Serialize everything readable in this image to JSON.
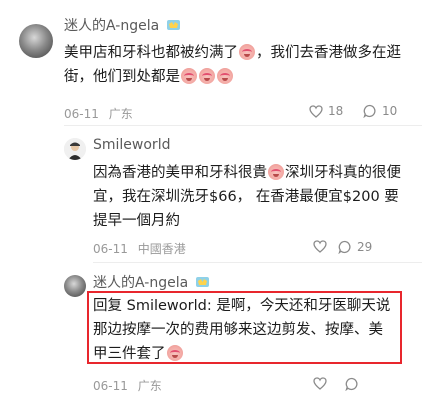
{
  "comments": [
    {
      "author": "迷人的A-ngela",
      "text_parts": [
        "美甲店和牙科也都被约满了",
        "，我们去香港做多在逛街，他们到处都是"
      ],
      "date": "06-11",
      "location": "广东",
      "likes": "18",
      "replies": "10"
    },
    {
      "author": "Smileworld",
      "text_parts": [
        "因為香港的美甲和牙科很貴",
        "深圳牙科真的很便宜，我在深圳洗牙$66， 在香港最便宜$200 要提早一個月約"
      ],
      "date": "06-11",
      "location": "中國香港",
      "likes": "",
      "replies": "29"
    },
    {
      "author": "迷人的A-ngela",
      "reply_prefix": "回复",
      "reply_to": "Smileworld",
      "text": ": 是啊，今天还和牙医聊天说那边按摩一次的费用够来这边剪发、按摩、美甲三件套了",
      "date": "06-11",
      "location": "广东",
      "likes": "",
      "replies": ""
    }
  ],
  "icons": {
    "like": "heart-icon",
    "comment": "comment-icon",
    "emoji": "crying-laughing-face-emoji",
    "name_badge": "crown-emoji"
  },
  "colors": {
    "highlight_border": "#e8262d",
    "meta": "#999999"
  }
}
